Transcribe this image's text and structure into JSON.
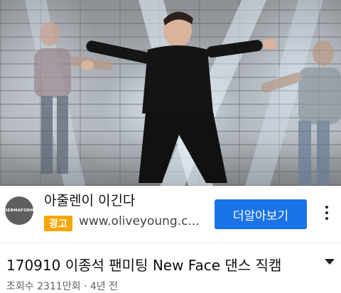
{
  "ad": {
    "logo_text": "DERMAFORM",
    "advertiser_name": "아줄렌이 이긴다",
    "badge": "광고",
    "url": "www.oliveyoung.c...",
    "cta_label": "더알아보기",
    "menu_icon": "more-vertical-icon",
    "brand_color": "#1a73e8",
    "badge_color": "#f5a700"
  },
  "video": {
    "title": "170910 이종석 팬미팅 New Face 댄스 직캠",
    "views": "조회수 2311만회",
    "separator": "·",
    "age": "4년 전",
    "expand_icon": "chevron-down-icon"
  }
}
